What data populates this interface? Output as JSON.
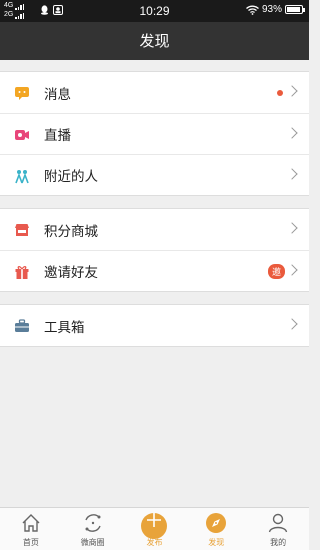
{
  "status_bar": {
    "net1": "4G",
    "net2": "2G",
    "time": "10:29",
    "battery": "93%",
    "battery_level": 0.93
  },
  "header": {
    "title": "发现"
  },
  "groups": [
    {
      "items": [
        {
          "label": "消息",
          "icon": "chat-bubble-icon",
          "indicator": "dot"
        },
        {
          "label": "直播",
          "icon": "live-video-icon"
        },
        {
          "label": "附近的人",
          "icon": "nearby-people-icon"
        }
      ]
    },
    {
      "items": [
        {
          "label": "积分商城",
          "icon": "store-icon"
        },
        {
          "label": "邀请好友",
          "icon": "gift-icon",
          "badge": "邀"
        }
      ]
    },
    {
      "items": [
        {
          "label": "工具箱",
          "icon": "toolbox-icon"
        }
      ]
    }
  ],
  "tabs": [
    {
      "label": "首页",
      "icon": "home-icon"
    },
    {
      "label": "微商圈",
      "icon": "circle-refresh-icon"
    },
    {
      "label": "发布",
      "icon": "plus-icon"
    },
    {
      "label": "发现",
      "icon": "compass-icon",
      "active": true
    },
    {
      "label": "我的",
      "icon": "user-icon"
    }
  ],
  "colors": {
    "accent": "#e8a33a",
    "badge": "#ea5a3c",
    "header_bg": "#333333",
    "status_bg": "#1a1a1a"
  }
}
